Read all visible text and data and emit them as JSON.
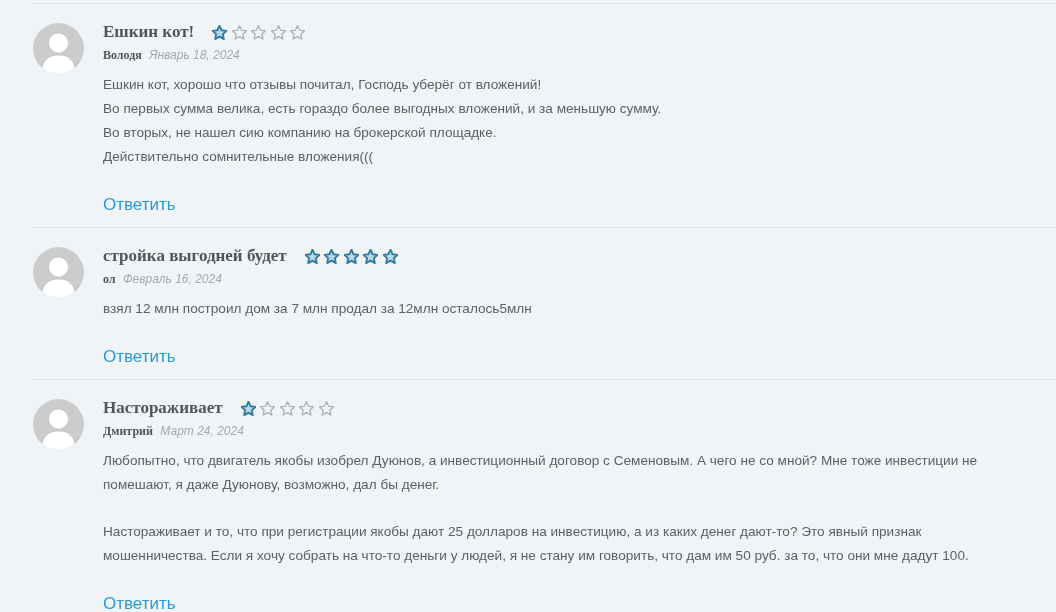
{
  "reviews": [
    {
      "title": "Ешкин кот!",
      "stars": 1,
      "author": "Володя",
      "date": "Январь 18, 2024",
      "body": [
        [
          "Ешкин кот, хорошо что отзывы почитал, Господь уберёг от вложений!",
          "Во первых сумма велика, есть гораздо более выгодных вложений, и за меньшую сумму.",
          "Во вторых, не нашел сию компанию на брокерской площадке.",
          "Действительно сомнительные вложения((("
        ]
      ],
      "reply": "Ответить"
    },
    {
      "title": "стройка выгодней будет",
      "stars": 5,
      "author": "ол",
      "date": "Февраль 16, 2024",
      "body": [
        [
          "взял 12 млн построил дом за 7 млн продал за 12млн осталось5млн"
        ]
      ],
      "reply": "Ответить"
    },
    {
      "title": "Настораживает",
      "stars": 1,
      "author": "Дмитрий",
      "date": "Март 24, 2024",
      "body": [
        [
          "Любопытно, что двигатель якобы изобрел Дуюнов, а инвестиционный договор с Семеновым. А чего не со мной? Мне тоже инвестиции не помешают, я даже Дуюнову, возможно, дал бы денег."
        ],
        [
          "Настораживает и то, что при регистрации якобы дают 25 долларов на инвестицию, а из каких денег дают-то? Это явный признак мошенничества. Если я хочу собрать на что-то деньги у людей, я не стану им говорить, что дам им 50 руб. за то, что они мне дадут 100."
        ]
      ],
      "reply": "Ответить"
    }
  ]
}
